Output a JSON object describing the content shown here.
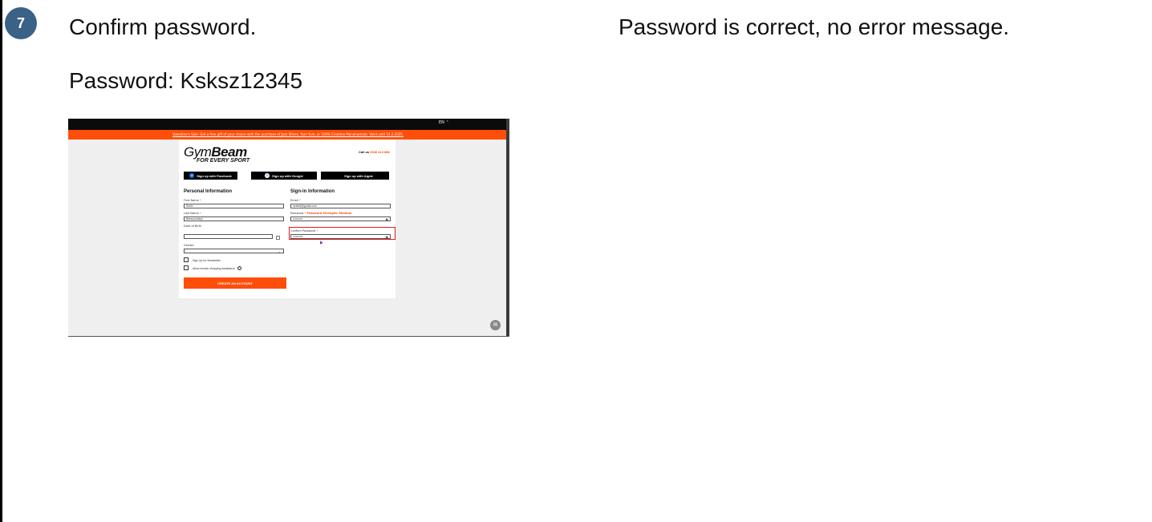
{
  "step": {
    "number": "7",
    "title": "Confirm password.",
    "detail": "Password: Ksksz12345",
    "expected": "Password is correct, no error message."
  },
  "screenshot": {
    "language": "EN ⌃",
    "promo_text": "Valentine's Sale: Get a free gift of your choice with the purchase of Jack Wines, Yum Yum, or 100% Creatine Monohydrate. Valid until 14.2.2025.",
    "logo_text_1": "Gym",
    "logo_text_2": "Beam",
    "logo_tagline": "FOR EVERY SPORT",
    "call_label": "Call us",
    "call_number": "0940 413 888",
    "social_buttons": {
      "facebook": "Sign up with Facebook",
      "google": "Sign up with Google",
      "apple": "Sign up with Apple"
    },
    "personal_section": "Personal Information",
    "signin_section": "Sign-in Information",
    "fields": {
      "first_name_label": "First Name",
      "first_name_value": "Serbi",
      "last_name_label": "Last Name",
      "last_name_value": "Bereczovskyi",
      "dob_label": "Date of Birth",
      "gender_label": "Gender",
      "email_label": "Email",
      "email_value": "sebebl@gmail.com",
      "password_label": "Password",
      "password_strength": "Password Strength: Medium",
      "password_value": "••••••••••",
      "confirm_label": "Confirm Password",
      "confirm_value": "••••••••••"
    },
    "newsletter_label": "Sign Up for Newsletter",
    "remote_label": "Allow remote shopping assistance",
    "required_mark": "*",
    "create_button": "CREATE AN ACCOUNT"
  },
  "colors": {
    "badge": "#3a6186",
    "brand_orange": "#ff4e0a",
    "highlight": "#e21b1b"
  }
}
